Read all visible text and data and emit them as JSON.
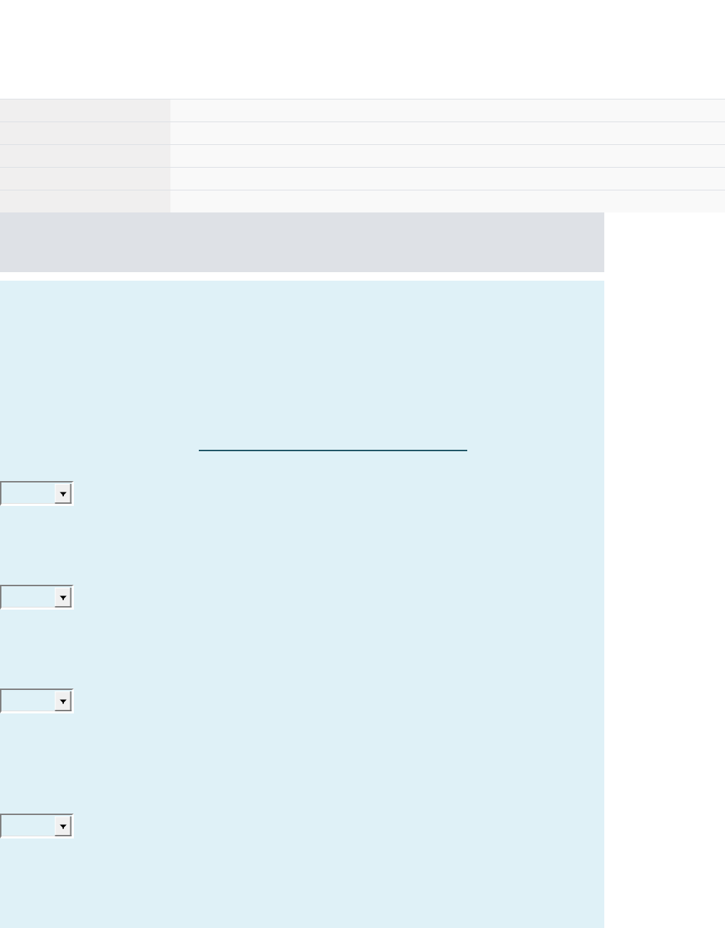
{
  "info_table": {
    "rows": [
      {
        "kind": "field-row"
      },
      {
        "kind": "field-row"
      },
      {
        "kind": "field-row"
      },
      {
        "kind": "field-row"
      },
      {
        "kind": "field-row"
      }
    ]
  },
  "banner": {
    "kind": "blank-bar"
  },
  "question_panel": {
    "items": [
      {
        "kind": "fill-in-line"
      },
      {
        "kind": "dropdown"
      },
      {
        "kind": "dropdown"
      },
      {
        "kind": "dropdown"
      },
      {
        "kind": "dropdown"
      }
    ]
  }
}
